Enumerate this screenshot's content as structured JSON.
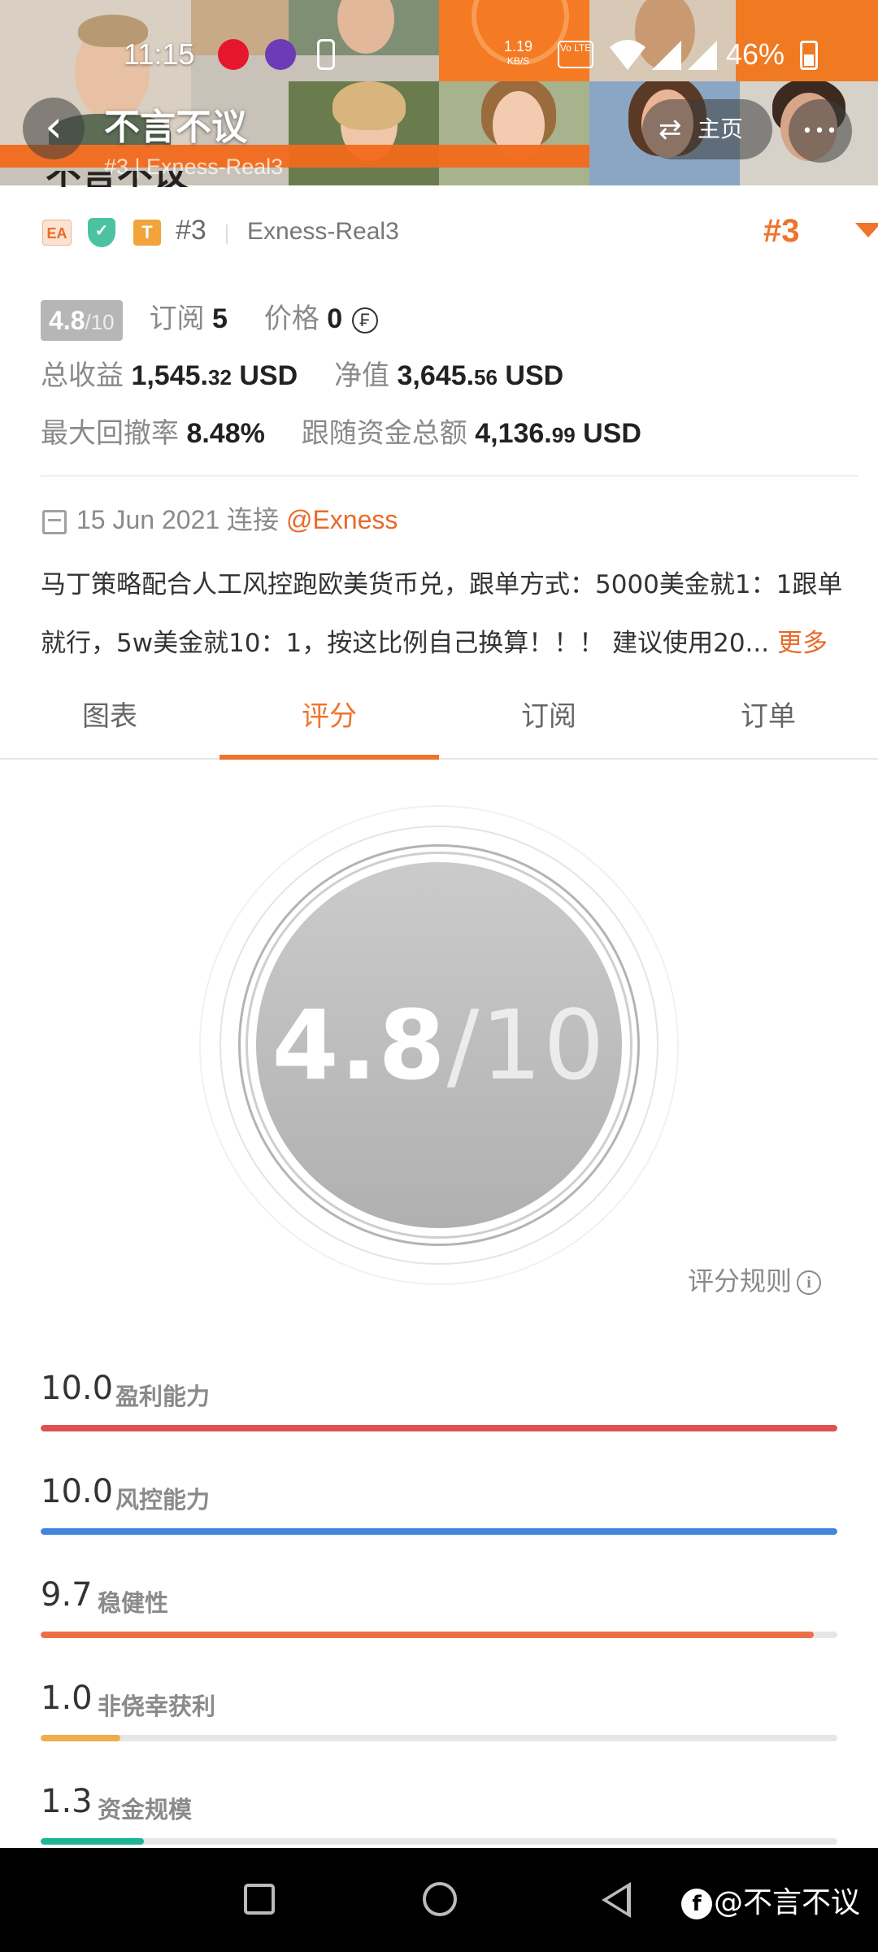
{
  "status_bar": {
    "time": "11:15",
    "net_speed_value": "1.19",
    "net_speed_unit": "KB/S",
    "volte_label": "Vo LTE",
    "battery": "46%"
  },
  "header": {
    "title": "不言不议",
    "subtitle": "#3 | Exness-Real3",
    "home_label": "主页",
    "back_icon": "‹",
    "more_icon": "•••"
  },
  "profile": {
    "title_partial": "不言不议",
    "tag_ea": "EA",
    "tag_shield": "✓",
    "tag_t": "T",
    "rank": "#3",
    "account": "Exness-Real3",
    "rank_big": "#3"
  },
  "stats": {
    "score": "4.8",
    "score_den": "/10",
    "subscribe_label": "订阅",
    "subscribe_value": "5",
    "price_label": "价格",
    "price_value": "0",
    "price_icon": "₣",
    "total_profit_label": "总收益",
    "total_profit_main": "1,545.",
    "total_profit_cents": "32",
    "total_profit_unit": "USD",
    "equity_label": "净值",
    "equity_main": "3,645.",
    "equity_cents": "56",
    "equity_unit": "USD",
    "drawdown_label": "最大回撤率",
    "drawdown_value": "8.48%",
    "follow_label": "跟随资金总额",
    "follow_main": "4,136.",
    "follow_cents": "99",
    "follow_unit": "USD"
  },
  "connection": {
    "date": "15 Jun 2021",
    "connect_label": "连接",
    "broker": "@Exness"
  },
  "description": {
    "line1": "马丁策略配合人工风控跑欧美货币兑，跟单方式：5000美金就1：1跟单",
    "line2": "就行，5w美金就10：1，按这比例自己换算！！！ 建议使用20...",
    "more": "更多"
  },
  "tabs": [
    "图表",
    "评分",
    "订阅",
    "订单"
  ],
  "active_tab": 1,
  "score_circle": {
    "value": "4.8",
    "den": "/10"
  },
  "rules_label": "评分规则",
  "metrics": [
    {
      "value": "10.0",
      "label": "盈利能力",
      "fraction": 1.0,
      "color": "#e0504f"
    },
    {
      "value": "10.0",
      "label": "风控能力",
      "fraction": 1.0,
      "color": "#3f86dc"
    },
    {
      "value": "9.7",
      "label": "稳健性",
      "fraction": 0.97,
      "color": "#ee6e45"
    },
    {
      "value": "1.0",
      "label": "非侥幸获利",
      "fraction": 0.1,
      "color": "#f0ad4a"
    },
    {
      "value": "1.3",
      "label": "资金规模",
      "fraction": 0.13,
      "color": "#1db592"
    }
  ],
  "watermark": {
    "logo": "f",
    "text": "@不言不议"
  },
  "colors": {
    "accent": "#f0732c",
    "header_orange": "#f26a1b"
  }
}
